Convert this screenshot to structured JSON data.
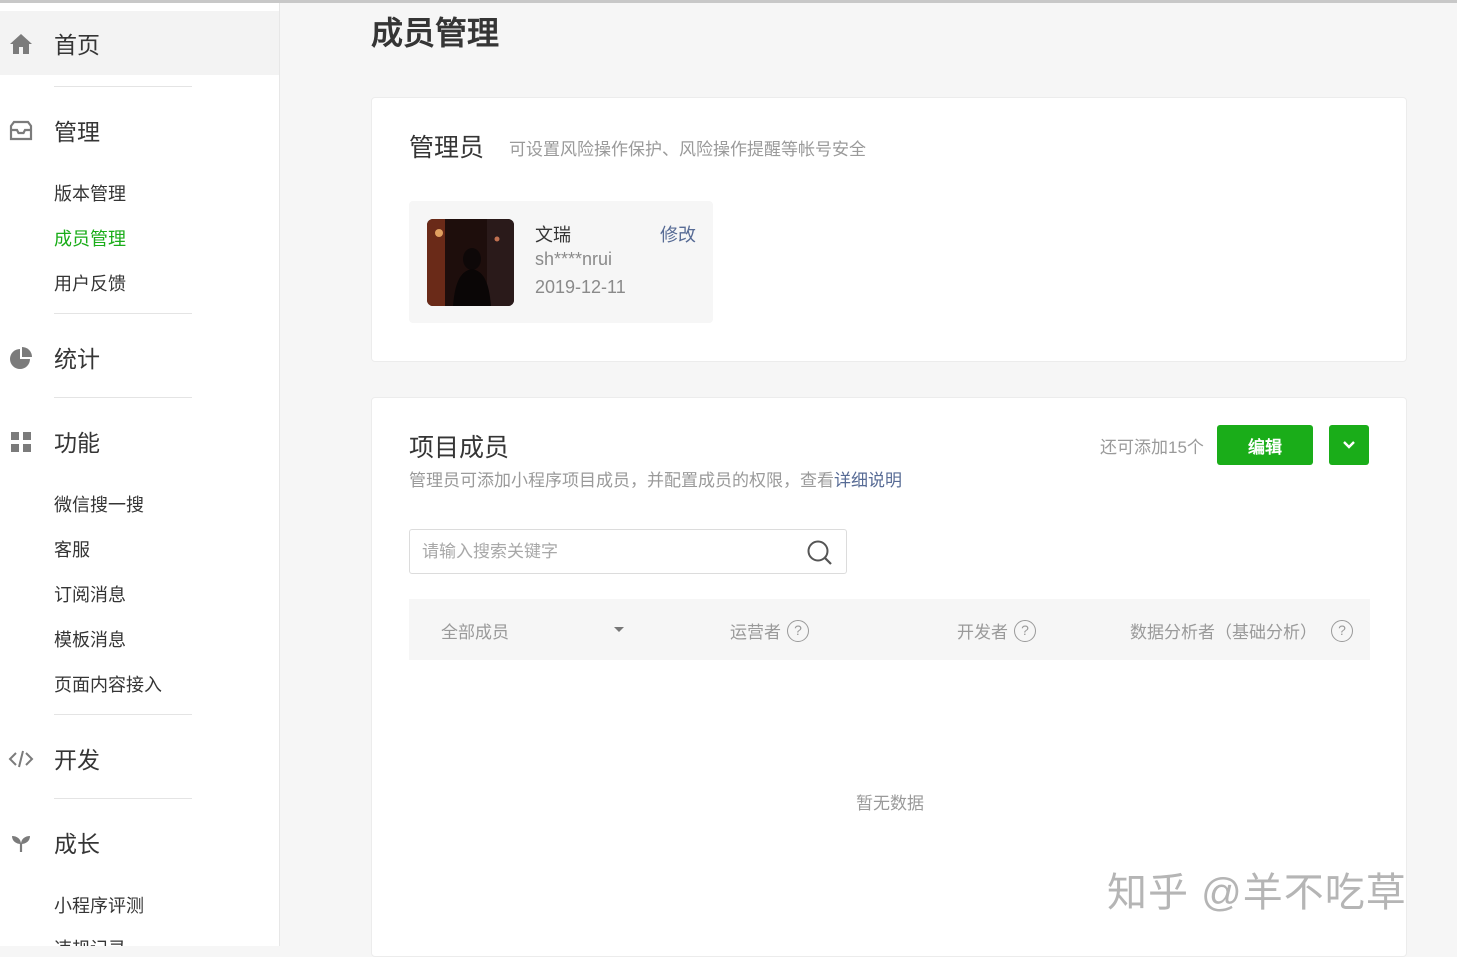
{
  "sidebar": {
    "home": "首页",
    "manage": {
      "label": "管理",
      "items": [
        "版本管理",
        "成员管理",
        "用户反馈"
      ]
    },
    "stats": "统计",
    "features": {
      "label": "功能",
      "items": [
        "微信搜一搜",
        "客服",
        "订阅消息",
        "模板消息",
        "页面内容接入"
      ]
    },
    "dev": "开发",
    "growth": {
      "label": "成长",
      "items": [
        "小程序评测",
        "违规记录"
      ]
    }
  },
  "page": {
    "title": "成员管理"
  },
  "admin_card": {
    "title": "管理员",
    "desc": "可设置风险操作保护、风险操作提醒等帐号安全",
    "name": "文瑞",
    "edit": "修改",
    "account": "sh****nrui",
    "date": "2019-12-11"
  },
  "members_card": {
    "title": "项目成员",
    "desc": "管理员可添加小程序项目成员，并配置成员的权限，查看",
    "desc_link": "详细说明",
    "remain": "还可添加15个",
    "edit_button": "编辑",
    "search_placeholder": "请输入搜索关键字",
    "columns": [
      "全部成员",
      "运营者",
      "开发者",
      "数据分析者（基础分析）"
    ],
    "help_mark": "?",
    "empty": "暂无数据"
  },
  "watermark": "知乎 @羊不吃草",
  "colors": {
    "accent": "#1aad19",
    "link": "#576b95"
  }
}
